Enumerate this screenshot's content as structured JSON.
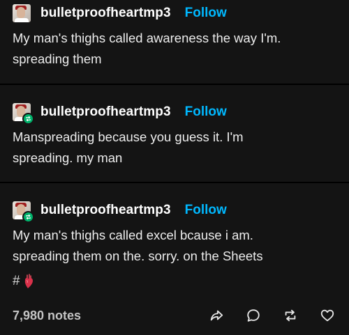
{
  "posts": [
    {
      "username": "bulletproofheartmp3",
      "follow_label": "Follow",
      "lines": [
        "My man's thighs called awareness the way I'm.",
        "spreading them"
      ],
      "reblogged": false
    },
    {
      "username": "bulletproofheartmp3",
      "follow_label": "Follow",
      "lines": [
        "Manspreading because you guess it. I'm",
        "spreading. my man"
      ],
      "reblogged": true
    },
    {
      "username": "bulletproofheartmp3",
      "follow_label": "Follow",
      "lines": [
        "My man's thighs called excel bcause i am.",
        "spreading them on the. sorry. on the Sheets"
      ],
      "reblogged": true
    }
  ],
  "tags": {
    "hash": "#",
    "emoji_icon": "anatomical-heart-icon"
  },
  "footer": {
    "notes": "7,980 notes",
    "actions": [
      "share-icon",
      "reply-icon",
      "reblog-icon",
      "like-icon"
    ]
  },
  "colors": {
    "background": "#141414",
    "follow": "#00b8ff",
    "reblog_badge": "#00b36b"
  }
}
